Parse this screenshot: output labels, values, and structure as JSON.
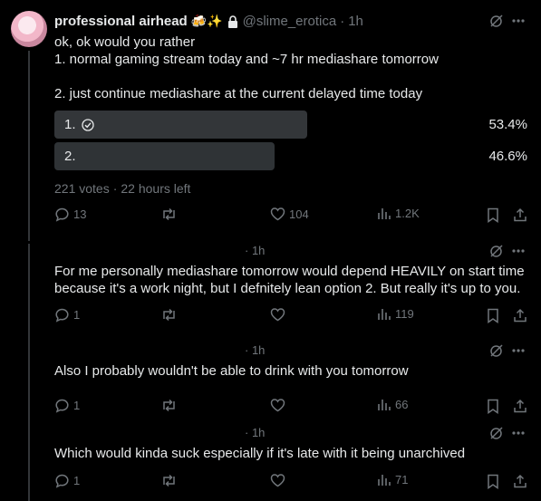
{
  "main_post": {
    "display_name": "professional airhead",
    "name_emojis": "🍻✨",
    "handle": "@slime_erotica",
    "separator": "·",
    "time": "1h",
    "text": "ok, ok would you rather\n1. normal gaming stream today and ~7 hr mediashare tomorrow\n\n2. just continue mediashare at the current delayed time today",
    "poll": {
      "options": [
        {
          "label": "1.",
          "percent": "53.4%",
          "share": 0.534,
          "winner": true
        },
        {
          "label": "2.",
          "percent": "46.6%",
          "share": 0.466,
          "winner": false
        }
      ],
      "votes": "221 votes",
      "time_left": "22 hours left",
      "meta_sep": "·"
    },
    "actions": {
      "replies": "13",
      "reposts": "",
      "likes": "104",
      "views": "1.2K"
    }
  },
  "replies": [
    {
      "time": "· 1h",
      "text": "For me personally mediashare tomorrow would depend HEAVILY on start time because it's a work night, but I defnitely lean option 2. But really it's up to you.",
      "actions": {
        "replies": "1",
        "views": "119"
      }
    },
    {
      "time": "· 1h",
      "text": "Also I probably wouldn't be able to drink with you tomorrow",
      "actions": {
        "replies": "1",
        "views": "66"
      }
    },
    {
      "time": "· 1h",
      "text": "Which would kinda suck especially if it's late with it being unarchived",
      "actions": {
        "replies": "1",
        "views": "71"
      }
    }
  ],
  "colors": {
    "background": "#000000",
    "text": "#e7e9ea",
    "muted": "#71767b",
    "poll_winner": "#333639",
    "poll_other": "#2f3336",
    "thread_line": "#333639"
  },
  "icons": [
    "grok-icon",
    "more-icon",
    "reply-icon",
    "repost-icon",
    "like-icon",
    "views-icon",
    "bookmark-icon",
    "share-icon",
    "lock-icon",
    "check-circle-icon"
  ]
}
